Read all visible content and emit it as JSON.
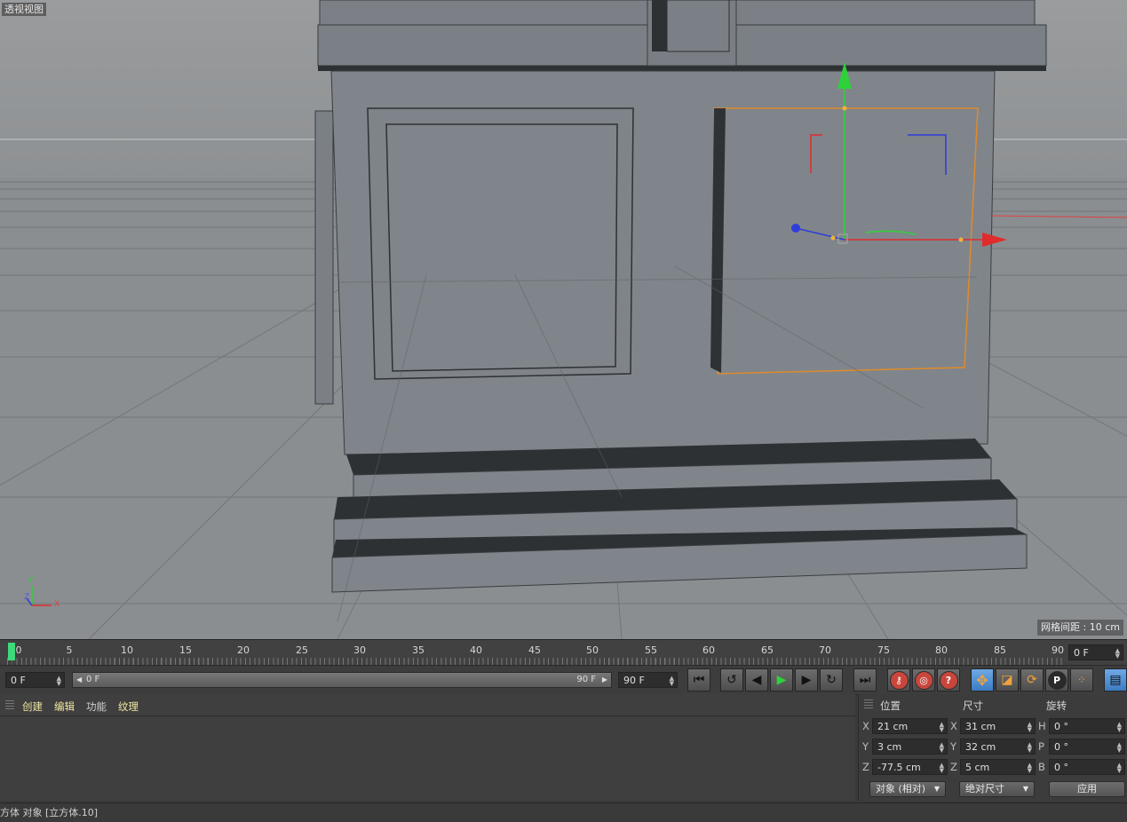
{
  "viewport": {
    "title": "透视视图",
    "grid_distance": "网格间距 : 10 cm",
    "axis_labels": {
      "y": "Y",
      "z": "Z",
      "x": "X"
    }
  },
  "timeline": {
    "ticks": [
      "0",
      "5",
      "10",
      "15",
      "20",
      "25",
      "30",
      "35",
      "40",
      "45",
      "50",
      "55",
      "60",
      "65",
      "70",
      "75",
      "80",
      "85",
      "90"
    ],
    "current_frame": "0 F"
  },
  "transport": {
    "start_field": "0 F",
    "range_start": "0 F",
    "range_end": "90 F",
    "end_field": "90 F",
    "buttons": [
      "goto-start",
      "play-backward-loop",
      "step-back",
      "play",
      "step-forward",
      "loop",
      "goto-end",
      "record-keyframe",
      "autokey",
      "help",
      "move-tool",
      "scale-tool",
      "rotate-tool",
      "parameter-tool",
      "points-mode",
      "film-icon"
    ]
  },
  "material_panel": {
    "menus": [
      "创建",
      "编辑",
      "功能",
      "纹理"
    ]
  },
  "coordinates": {
    "headers": {
      "position": "位置",
      "size": "尺寸",
      "rotation": "旋转"
    },
    "rows": [
      {
        "axis_p": "X",
        "pos": "21 cm",
        "axis_s": "X",
        "size": "31 cm",
        "axis_r": "H",
        "rot": "0 °"
      },
      {
        "axis_p": "Y",
        "pos": "3 cm",
        "axis_s": "Y",
        "size": "32 cm",
        "axis_r": "P",
        "rot": "0 °"
      },
      {
        "axis_p": "Z",
        "pos": "-77.5 cm",
        "axis_s": "Z",
        "size": "5 cm",
        "axis_r": "B",
        "rot": "0 °"
      }
    ],
    "mode_dropdown": "对象 (相对)",
    "size_dropdown": "绝对尺寸",
    "apply_button": "应用"
  },
  "status_bar": "方体 对象 [立方体.10]"
}
